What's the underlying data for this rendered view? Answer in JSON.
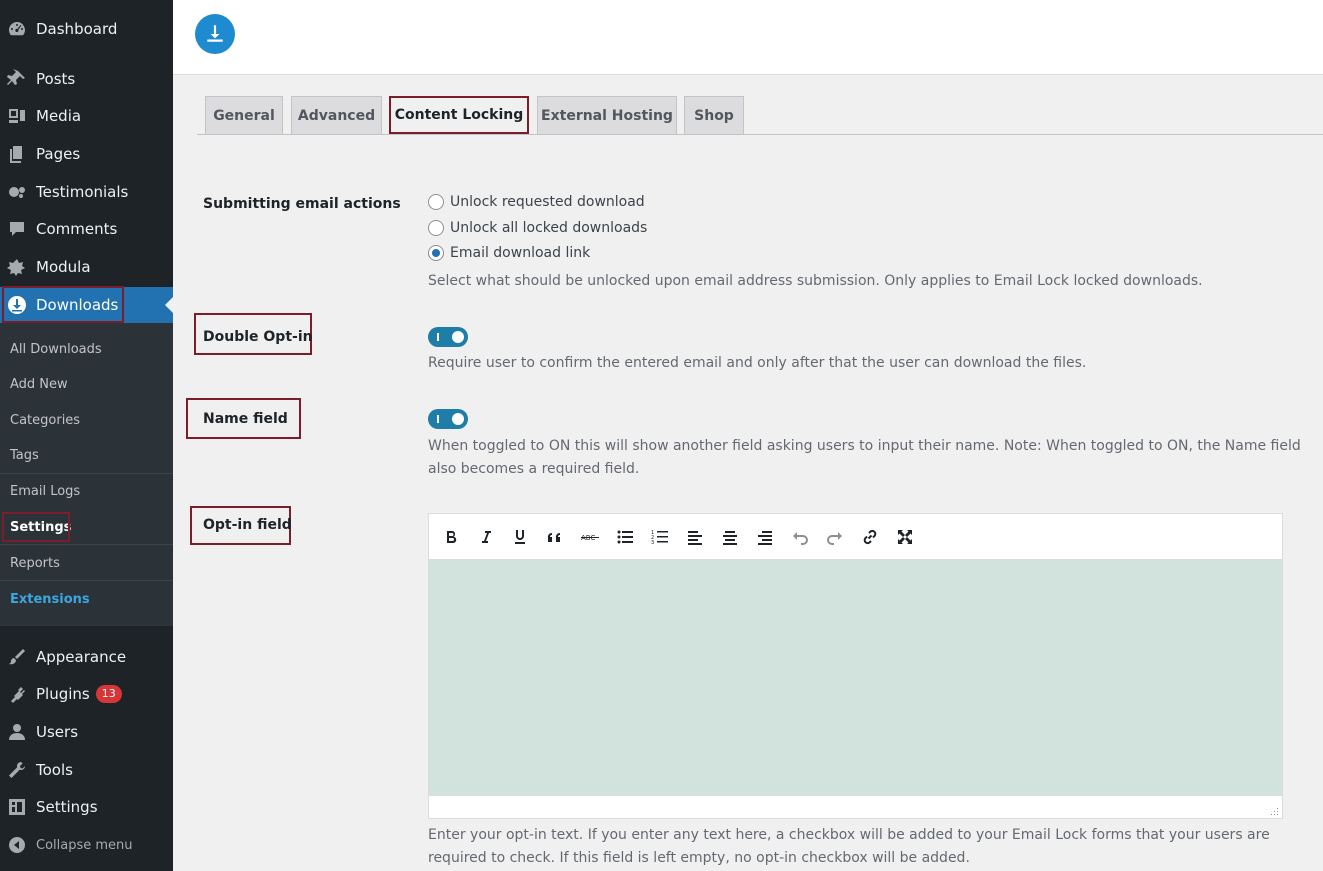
{
  "sidebar": {
    "menu": {
      "dashboard": "Dashboard",
      "posts": "Posts",
      "media": "Media",
      "pages": "Pages",
      "testimonials": "Testimonials",
      "comments": "Comments",
      "modula": "Modula",
      "downloads": "Downloads",
      "appearance": "Appearance",
      "plugins": "Plugins",
      "plugins_badge": "13",
      "users": "Users",
      "tools": "Tools",
      "settings": "Settings",
      "collapse": "Collapse menu"
    },
    "submenu": {
      "all_downloads": "All Downloads",
      "add_new": "Add New",
      "categories": "Categories",
      "tags": "Tags",
      "email_logs": "Email Logs",
      "settings": "Settings",
      "reports": "Reports",
      "extensions": "Extensions"
    }
  },
  "tabs": {
    "general": "General",
    "advanced": "Advanced",
    "content_locking": "Content Locking",
    "external_hosting": "External Hosting",
    "shop": "Shop",
    "active": "Content Locking"
  },
  "form": {
    "email_actions": {
      "label": "Submitting email actions",
      "options": [
        "Unlock requested download",
        "Unlock all locked downloads",
        "Email download link"
      ],
      "selected": "Email download link",
      "description": "Select what should be unlocked upon email address submission. Only applies to Email Lock locked downloads."
    },
    "double_optin": {
      "label": "Double Opt-in",
      "enabled": true,
      "description": "Require user to confirm the entered email and only after that the user can download the files."
    },
    "name_field": {
      "label": "Name field",
      "enabled": true,
      "description_line1": "When toggled to ON this will show another field asking users to input their name. Note: When toggled to ON, the Name field",
      "description_line2": "also becomes a required field."
    },
    "optin_field": {
      "label": "Opt-in field",
      "toolbar": [
        "bold-icon",
        "italic-icon",
        "underline-icon",
        "blockquote-icon",
        "strikethrough-icon",
        "bullet-list-icon",
        "numbered-list-icon",
        "align-left-icon",
        "align-center-icon",
        "align-right-icon",
        "undo-icon",
        "redo-icon",
        "link-icon",
        "fullscreen-icon"
      ],
      "description_line1": "Enter your opt-in text. If you enter any text here, a checkbox will be added to your Email Lock forms that your users are",
      "description_line2": "required to check. If this field is left empty, no opt-in checkbox will be added."
    }
  },
  "colors": {
    "sidebar_bg": "#1d2327",
    "submenu_bg": "#2c3338",
    "accent": "#2271b1",
    "highlight_box": "#7b1d2a",
    "toggle_on": "#1e7ea8",
    "editor_bg": "#d2e3de"
  }
}
